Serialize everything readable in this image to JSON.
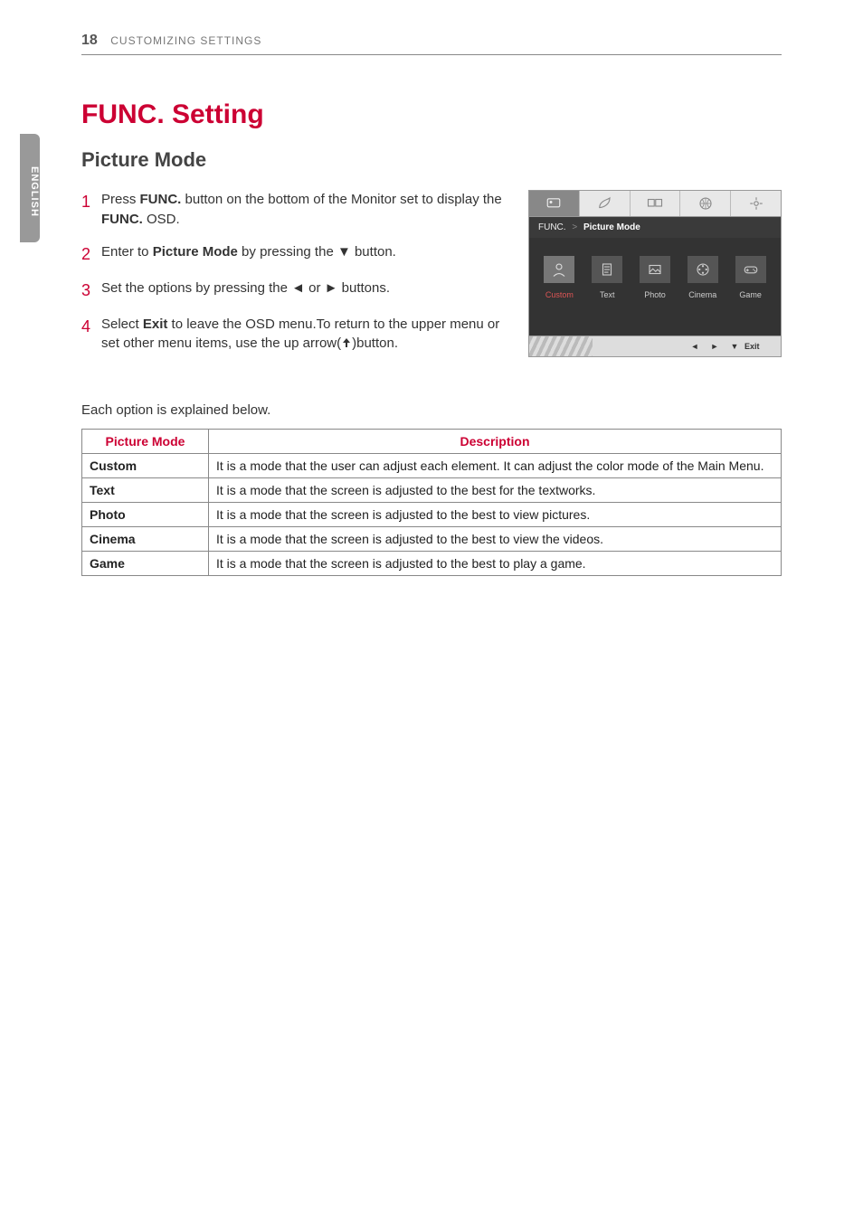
{
  "page": {
    "number": "18",
    "section": "CUSTOMIZING SETTINGS"
  },
  "sidetab": "ENGLISH",
  "title": "FUNC. Setting",
  "subtitle": "Picture Mode",
  "steps": [
    {
      "n": "1",
      "pre": "Press ",
      "b1": "FUNC.",
      "mid1": " button on   the bottom of the Monitor set to display the ",
      "b2": "FUNC.",
      "mid2": " OSD."
    },
    {
      "n": "2",
      "pre": "Enter to ",
      "b1": "Picture Mode",
      "mid1": " by pressing the ▼ button.",
      "b2": "",
      "mid2": ""
    },
    {
      "n": "3",
      "pre": "Set the options by pressing the ◄ or ► buttons.",
      "b1": "",
      "mid1": "",
      "b2": "",
      "mid2": ""
    },
    {
      "n": "4",
      "pre": "Select ",
      "b1": "Exit",
      "mid1": " to leave the OSD menu.To return to the upper menu or set other menu items, use  the up arrow(",
      "b2": "",
      "mid2": ")button."
    }
  ],
  "osd": {
    "breadcrumb_a": "FUNC.",
    "breadcrumb_sep": ">",
    "breadcrumb_b": "Picture Mode",
    "options": [
      {
        "label": "Custom"
      },
      {
        "label": "Text"
      },
      {
        "label": "Photo"
      },
      {
        "label": "Cinema"
      },
      {
        "label": "Game"
      }
    ],
    "footer": {
      "left": "◄",
      "right": "►",
      "down": "▼",
      "exit": "Exit"
    }
  },
  "explain": "Each option is explained below.",
  "table": {
    "h1": "Picture Mode",
    "h2": "Description",
    "rows": [
      {
        "k": "Custom",
        "v": "It is a mode that the user can adjust each element. It can adjust the color mode of the Main Menu."
      },
      {
        "k": "Text",
        "v": "It is a mode that the screen is adjusted to the best for the textworks."
      },
      {
        "k": "Photo",
        "v": "It is a mode that the screen is adjusted to the best to view pictures."
      },
      {
        "k": "Cinema",
        "v": "It is a mode that the screen is adjusted to the best to view the videos."
      },
      {
        "k": "Game",
        "v": "It is a mode that the screen is adjusted to the best to play a game."
      }
    ]
  }
}
